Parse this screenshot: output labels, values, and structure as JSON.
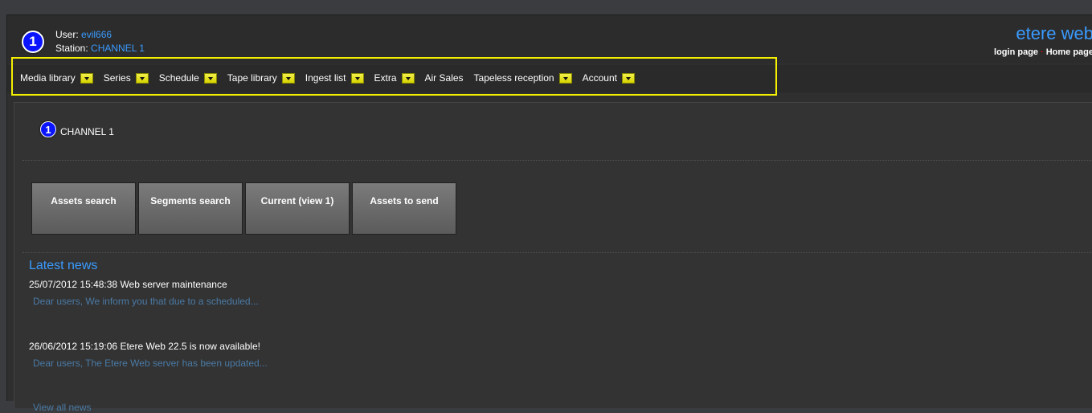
{
  "user": {
    "user_label": "User:",
    "user_value": "evil666",
    "station_label": "Station:",
    "station_value": "CHANNEL 1",
    "badge": "1"
  },
  "brand": {
    "name": "etere web",
    "login_link": "login page",
    "home_link": "Home page"
  },
  "nav": {
    "items": [
      {
        "label": "Media library",
        "dropdown": true
      },
      {
        "label": "Series",
        "dropdown": true
      },
      {
        "label": "Schedule",
        "dropdown": true
      },
      {
        "label": "Tape library",
        "dropdown": true
      },
      {
        "label": "Ingest list",
        "dropdown": true
      },
      {
        "label": "Extra",
        "dropdown": true
      },
      {
        "label": "Air Sales",
        "dropdown": false
      },
      {
        "label": "Tapeless reception",
        "dropdown": true
      },
      {
        "label": "Account",
        "dropdown": true
      }
    ]
  },
  "station": {
    "badge": "1",
    "title": "CHANNEL 1"
  },
  "buttons": [
    "Assets search",
    "Segments search",
    "Current (view 1)",
    "Assets to send"
  ],
  "news": {
    "title": "Latest news",
    "items": [
      {
        "headline": "25/07/2012 15:48:38 Web server maintenance",
        "snippet": "Dear users, We inform you that due to a scheduled..."
      },
      {
        "headline": "26/06/2012 15:19:06 Etere Web 22.5 is now available!",
        "snippet": "Dear users, The Etere Web server has been updated..."
      }
    ],
    "view_all": "View all news"
  },
  "colors": {
    "accent": "#3a9bff",
    "nav_outline": "#f4f000",
    "badge": "#0a14ff",
    "link": "#4a7aa5"
  }
}
